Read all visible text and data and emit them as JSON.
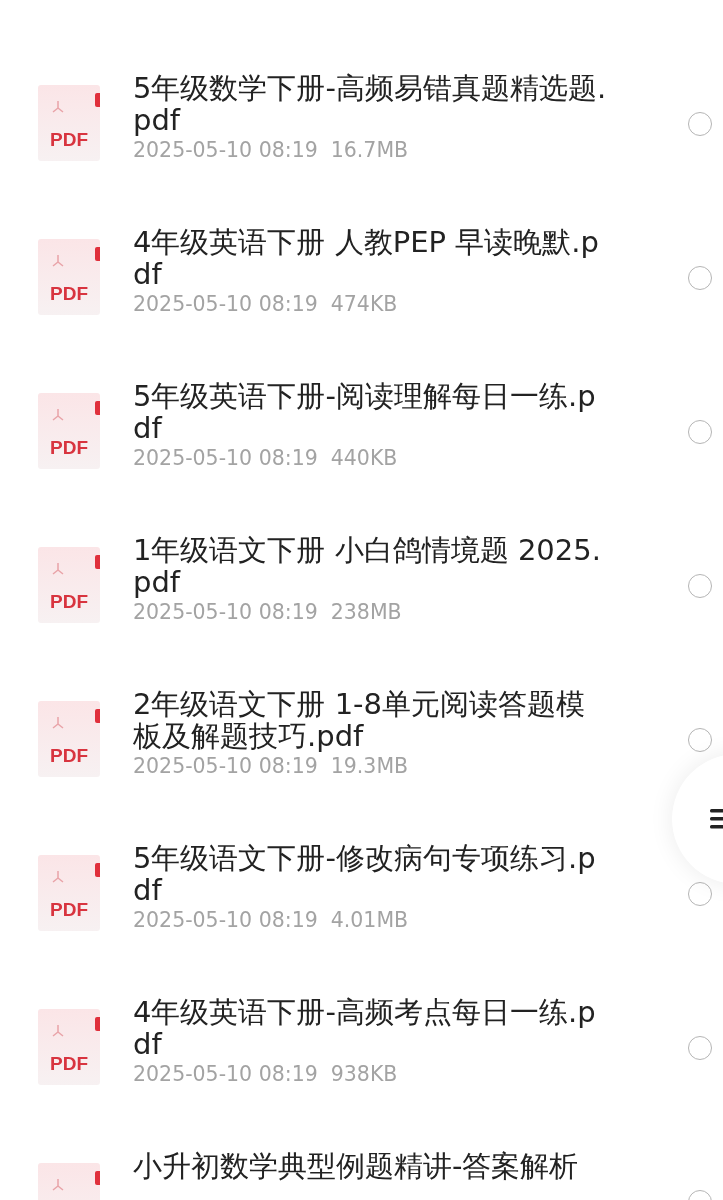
{
  "files": [
    {
      "pdf_label": "PDF",
      "title": "5年级数学下册-高频易错真题精选题.pdf",
      "meta": "2025-05-10 08:19  16.7MB",
      "selected": false
    },
    {
      "pdf_label": "PDF",
      "title": "4年级英语下册 人教PEP 早读晚默.pdf",
      "meta": "2025-05-10 08:19  474KB",
      "selected": false
    },
    {
      "pdf_label": "PDF",
      "title": "5年级英语下册-阅读理解每日一练.pdf",
      "meta": "2025-05-10 08:19  440KB",
      "selected": false
    },
    {
      "pdf_label": "PDF",
      "title": "1年级语文下册 小白鸽情境题 2025.pdf",
      "meta": "2025-05-10 08:19  238MB",
      "selected": false
    },
    {
      "pdf_label": "PDF",
      "title": "2年级语文下册 1-8单元阅读答题模板及解题技巧.pdf",
      "meta": "2025-05-10 08:19  19.3MB",
      "selected": false
    },
    {
      "pdf_label": "PDF",
      "title": "5年级语文下册-修改病句专项练习.pdf",
      "meta": "2025-05-10 08:19  4.01MB",
      "selected": false
    },
    {
      "pdf_label": "PDF",
      "title": "4年级英语下册-高频考点每日一练.pdf",
      "meta": "2025-05-10 08:19  938KB",
      "selected": false
    },
    {
      "title": "小升初数学典型例题精讲-答案解析",
      "selected": false
    }
  ]
}
